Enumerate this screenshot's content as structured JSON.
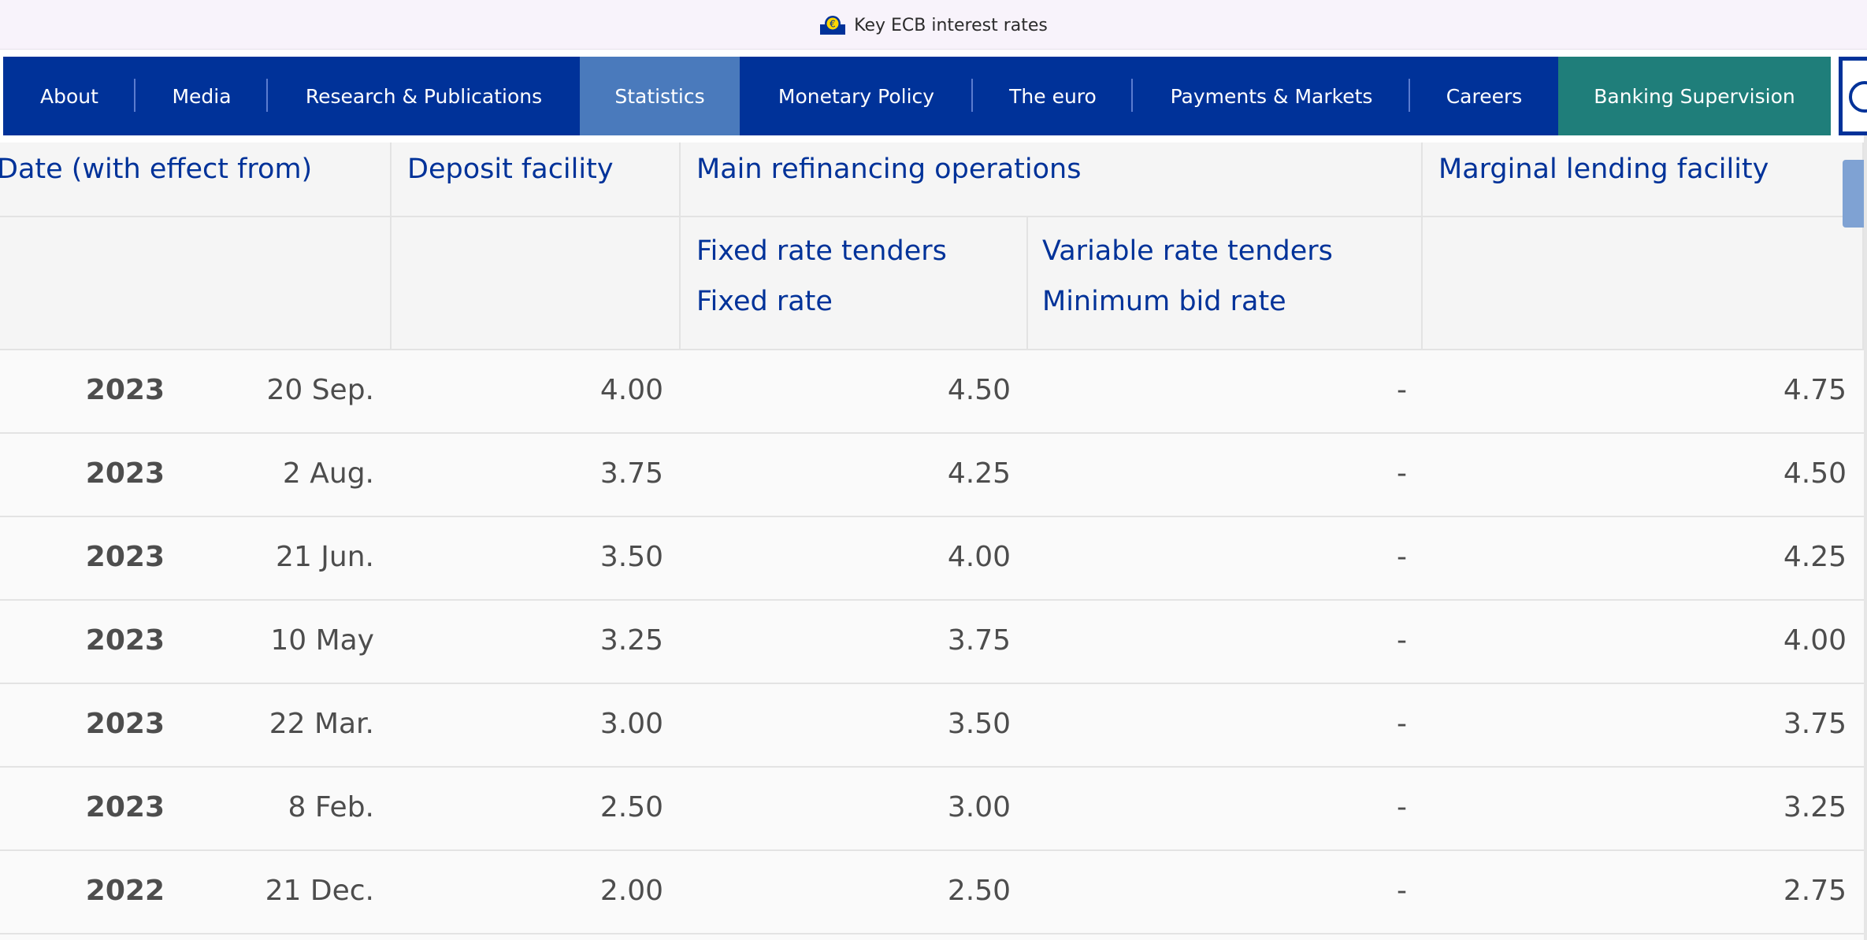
{
  "window": {
    "title": "Key ECB interest rates",
    "favicon": "ecb-euro-icon"
  },
  "nav": {
    "items": [
      {
        "label": "About"
      },
      {
        "label": "Media"
      },
      {
        "label": "Research & Publications"
      },
      {
        "label": "Statistics",
        "active": true
      },
      {
        "label": "Monetary Policy"
      },
      {
        "label": "The euro"
      },
      {
        "label": "Payments & Markets"
      },
      {
        "label": "Careers"
      },
      {
        "label": "Banking Supervision",
        "highlight": true
      }
    ],
    "colors": {
      "background": "#003299",
      "active": "#4a7abc",
      "banking": "#1f7e7a"
    }
  },
  "table": {
    "headers": {
      "date": "Date (with effect from)",
      "deposit": "Deposit facility",
      "mro": "Main refinancing operations",
      "mlf": "Marginal lending facility",
      "fixed_line1": "Fixed rate tenders",
      "fixed_line2": "Fixed rate",
      "variable_line1": "Variable rate tenders",
      "variable_line2": "Minimum bid rate"
    },
    "rows": [
      {
        "year": "2023",
        "date": "20 Sep.",
        "deposit": "4.00",
        "fixed": "4.50",
        "variable": "-",
        "mlf": "4.75"
      },
      {
        "year": "2023",
        "date": "2 Aug.",
        "deposit": "3.75",
        "fixed": "4.25",
        "variable": "-",
        "mlf": "4.50"
      },
      {
        "year": "2023",
        "date": "21 Jun.",
        "deposit": "3.50",
        "fixed": "4.00",
        "variable": "-",
        "mlf": "4.25"
      },
      {
        "year": "2023",
        "date": "10 May",
        "deposit": "3.25",
        "fixed": "3.75",
        "variable": "-",
        "mlf": "4.00"
      },
      {
        "year": "2023",
        "date": "22 Mar.",
        "deposit": "3.00",
        "fixed": "3.50",
        "variable": "-",
        "mlf": "3.75"
      },
      {
        "year": "2023",
        "date": "8 Feb.",
        "deposit": "2.50",
        "fixed": "3.00",
        "variable": "-",
        "mlf": "3.25"
      },
      {
        "year": "2022",
        "date": "21 Dec.",
        "deposit": "2.00",
        "fixed": "2.50",
        "variable": "-",
        "mlf": "2.75"
      }
    ],
    "colors": {
      "header_text": "#003299",
      "body_text": "#4d4d4d"
    }
  }
}
